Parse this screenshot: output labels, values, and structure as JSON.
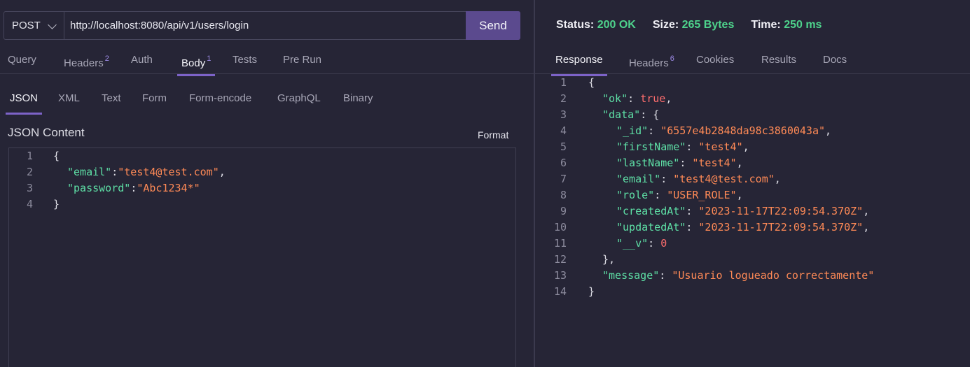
{
  "request": {
    "method": "POST",
    "url": "http://localhost:8080/api/v1/users/login",
    "send_label": "Send"
  },
  "request_tabs": [
    {
      "label": "Query",
      "badge": ""
    },
    {
      "label": "Headers",
      "badge": "2"
    },
    {
      "label": "Auth",
      "badge": ""
    },
    {
      "label": "Body",
      "badge": "1",
      "active": true
    },
    {
      "label": "Tests",
      "badge": ""
    },
    {
      "label": "Pre Run",
      "badge": ""
    }
  ],
  "body_tabs": [
    {
      "label": "JSON",
      "active": true
    },
    {
      "label": "XML"
    },
    {
      "label": "Text"
    },
    {
      "label": "Form"
    },
    {
      "label": "Form-encode"
    },
    {
      "label": "GraphQL"
    },
    {
      "label": "Binary"
    }
  ],
  "editor": {
    "title": "JSON Content",
    "format_label": "Format",
    "lines": [
      {
        "n": "1",
        "indent": 0,
        "parts": [
          [
            "p",
            "{"
          ]
        ]
      },
      {
        "n": "2",
        "indent": 1,
        "parts": [
          [
            "k",
            "\"email\""
          ],
          [
            "p",
            ":"
          ],
          [
            "s",
            "\"test4@test.com\""
          ],
          [
            "p",
            ","
          ]
        ]
      },
      {
        "n": "3",
        "indent": 1,
        "parts": [
          [
            "k",
            "\"password\""
          ],
          [
            "p",
            ":"
          ],
          [
            "s",
            "\"Abc1234*\""
          ]
        ]
      },
      {
        "n": "4",
        "indent": 0,
        "parts": [
          [
            "p",
            "}"
          ]
        ]
      }
    ]
  },
  "response": {
    "status_label": "Status:",
    "status_value": "200 OK",
    "size_label": "Size:",
    "size_value": "265 Bytes",
    "time_label": "Time:",
    "time_value": "250 ms",
    "tabs": [
      {
        "label": "Response",
        "badge": "",
        "active": true
      },
      {
        "label": "Headers",
        "badge": "6"
      },
      {
        "label": "Cookies",
        "badge": ""
      },
      {
        "label": "Results",
        "badge": ""
      },
      {
        "label": "Docs",
        "badge": ""
      }
    ],
    "lines": [
      {
        "n": "1",
        "indent": 0,
        "parts": [
          [
            "p",
            "{"
          ]
        ]
      },
      {
        "n": "2",
        "indent": 1,
        "parts": [
          [
            "k",
            "\"ok\""
          ],
          [
            "p",
            ": "
          ],
          [
            "b",
            "true"
          ],
          [
            "p",
            ","
          ]
        ]
      },
      {
        "n": "3",
        "indent": 1,
        "parts": [
          [
            "k",
            "\"data\""
          ],
          [
            "p",
            ": {"
          ]
        ]
      },
      {
        "n": "4",
        "indent": 2,
        "parts": [
          [
            "k",
            "\"_id\""
          ],
          [
            "p",
            ": "
          ],
          [
            "s",
            "\"6557e4b2848da98c3860043a\""
          ],
          [
            "p",
            ","
          ]
        ]
      },
      {
        "n": "5",
        "indent": 2,
        "parts": [
          [
            "k",
            "\"firstName\""
          ],
          [
            "p",
            ": "
          ],
          [
            "s",
            "\"test4\""
          ],
          [
            "p",
            ","
          ]
        ]
      },
      {
        "n": "6",
        "indent": 2,
        "parts": [
          [
            "k",
            "\"lastName\""
          ],
          [
            "p",
            ": "
          ],
          [
            "s",
            "\"test4\""
          ],
          [
            "p",
            ","
          ]
        ]
      },
      {
        "n": "7",
        "indent": 2,
        "parts": [
          [
            "k",
            "\"email\""
          ],
          [
            "p",
            ": "
          ],
          [
            "s",
            "\"test4@test.com\""
          ],
          [
            "p",
            ","
          ]
        ]
      },
      {
        "n": "8",
        "indent": 2,
        "parts": [
          [
            "k",
            "\"role\""
          ],
          [
            "p",
            ": "
          ],
          [
            "s",
            "\"USER_ROLE\""
          ],
          [
            "p",
            ","
          ]
        ]
      },
      {
        "n": "9",
        "indent": 2,
        "parts": [
          [
            "k",
            "\"createdAt\""
          ],
          [
            "p",
            ": "
          ],
          [
            "s",
            "\"2023-11-17T22:09:54.370Z\""
          ],
          [
            "p",
            ","
          ]
        ]
      },
      {
        "n": "10",
        "indent": 2,
        "parts": [
          [
            "k",
            "\"updatedAt\""
          ],
          [
            "p",
            ": "
          ],
          [
            "s",
            "\"2023-11-17T22:09:54.370Z\""
          ],
          [
            "p",
            ","
          ]
        ]
      },
      {
        "n": "11",
        "indent": 2,
        "parts": [
          [
            "k",
            "\"__v\""
          ],
          [
            "p",
            ": "
          ],
          [
            "n",
            "0"
          ]
        ]
      },
      {
        "n": "12",
        "indent": 1,
        "parts": [
          [
            "p",
            "},"
          ]
        ]
      },
      {
        "n": "13",
        "indent": 1,
        "parts": [
          [
            "k",
            "\"message\""
          ],
          [
            "p",
            ": "
          ],
          [
            "s",
            "\"Usuario logueado correctamente\""
          ]
        ]
      },
      {
        "n": "14",
        "indent": 0,
        "parts": [
          [
            "p",
            "}"
          ]
        ]
      }
    ]
  },
  "colors": {
    "background": "#262536",
    "accent": "#7d63c8",
    "send_button": "#5b4a8e",
    "json_key": "#5ee0a6",
    "json_string": "#ff8a56",
    "json_literal": "#ff6e6e",
    "status_ok": "#4ed38c"
  }
}
